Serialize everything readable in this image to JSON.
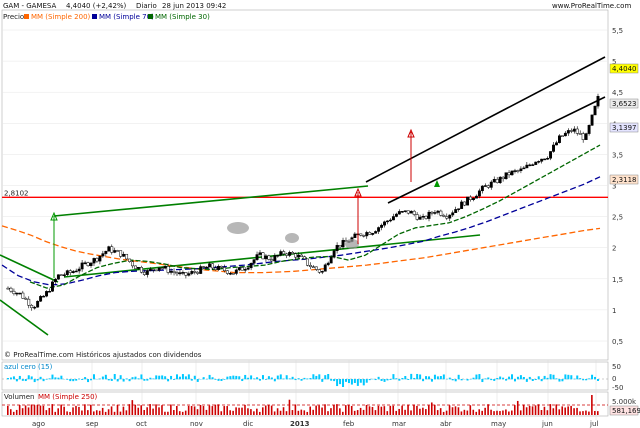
{
  "header": {
    "title": "GAM - GAMESA",
    "price": "4,4040 (+2,42%)",
    "period": "Diario",
    "datetime": "28 jun 2013 09:42",
    "source": "www.ProRealTime.com"
  },
  "legend": {
    "precio": "Precio",
    "mm200": "MM (Simple 200)",
    "mm70": "MM (Simple 70)",
    "mm30": "MM (Simple 30)",
    "watermark": "© ProRealTime.com Históricos ajustados con dividendos"
  },
  "indicators": {
    "mid_title": "azul cero (15)",
    "mid_ticks": [
      "50",
      "0",
      "-50"
    ],
    "vol_title": "Volumen",
    "vol_ma": "MM (Simple 250)",
    "vol_ticks": [
      "5.000k",
      "0,000k"
    ],
    "vol_badge": "581,169"
  },
  "badges": {
    "last": "4,4040",
    "mm30": "3,6523",
    "mm70": "3,1397",
    "mm200": "2,3118",
    "hline": "2,8102"
  },
  "colors": {
    "up": "#000000",
    "down": "#ffffff",
    "mm200": "#ff6600",
    "mm70": "#000099",
    "mm30": "#006600",
    "resistance": "#ff0000",
    "channel_green": "#008000",
    "channel_black": "#000000",
    "indicator": "#00c8ff",
    "volume": "#cc0000"
  },
  "chart_data": {
    "type": "line",
    "y_axis": {
      "min": 0.5,
      "max": 5.5,
      "ticks": [
        "5,5",
        "5",
        "4,5",
        "4",
        "3,5",
        "3",
        "2,5",
        "2",
        "1,5",
        "1",
        "0,5"
      ]
    },
    "x_ticks": [
      "ago",
      "sep",
      "oct",
      "nov",
      "dic",
      "2013",
      "feb",
      "mar",
      "abr",
      "may",
      "jun",
      "jul"
    ],
    "hline": 2.8102,
    "series": [
      {
        "name": "Precio",
        "values": [
          1.35,
          1.25,
          1.05,
          1.25,
          1.55,
          1.6,
          1.72,
          1.82,
          1.98,
          1.9,
          1.72,
          1.6,
          1.7,
          1.62,
          1.55,
          1.62,
          1.7,
          1.65,
          1.6,
          1.7,
          1.88,
          1.82,
          1.92,
          1.88,
          1.72,
          1.6,
          2.0,
          2.1,
          2.22,
          2.26,
          2.4,
          2.55,
          2.58,
          2.45,
          2.6,
          2.52,
          2.68,
          2.82,
          2.98,
          3.08,
          3.2,
          3.25,
          3.4,
          3.48,
          3.78,
          3.9,
          3.75,
          4.4
        ]
      },
      {
        "name": "MM (Simple 200)",
        "values": [
          2.35,
          2.28,
          2.2,
          2.1,
          2.02,
          1.95,
          1.9,
          1.86,
          1.82,
          1.79,
          1.76,
          1.73,
          1.7,
          1.67,
          1.64,
          1.62,
          1.6,
          1.6,
          1.6,
          1.61,
          1.62,
          1.64,
          1.66,
          1.68,
          1.7,
          1.72,
          1.75,
          1.78,
          1.81,
          1.84,
          1.88,
          1.92,
          1.96,
          2.0,
          2.04,
          2.08,
          2.12,
          2.16,
          2.2,
          2.24,
          2.28,
          2.31
        ]
      },
      {
        "name": "MM (Simple 70)",
        "values": [
          1.72,
          1.55,
          1.45,
          1.4,
          1.42,
          1.48,
          1.55,
          1.6,
          1.62,
          1.63,
          1.64,
          1.65,
          1.66,
          1.68,
          1.7,
          1.72,
          1.75,
          1.78,
          1.8,
          1.82,
          1.85,
          1.88,
          1.92,
          1.96,
          2.0,
          2.05,
          2.1,
          2.18,
          2.25,
          2.33,
          2.42,
          2.52,
          2.62,
          2.72,
          2.82,
          2.92,
          3.02,
          3.14
        ]
      },
      {
        "name": "MM (Simple 30)",
        "values": [
          1.45,
          1.35,
          1.4,
          1.55,
          1.68,
          1.75,
          1.8,
          1.78,
          1.74,
          1.68,
          1.66,
          1.65,
          1.68,
          1.7,
          1.72,
          1.78,
          1.82,
          1.85,
          1.86,
          1.8,
          1.88,
          2.05,
          2.22,
          2.32,
          2.36,
          2.4,
          2.5,
          2.62,
          2.75,
          2.9,
          3.05,
          3.2,
          3.35,
          3.5,
          3.65
        ]
      }
    ]
  }
}
